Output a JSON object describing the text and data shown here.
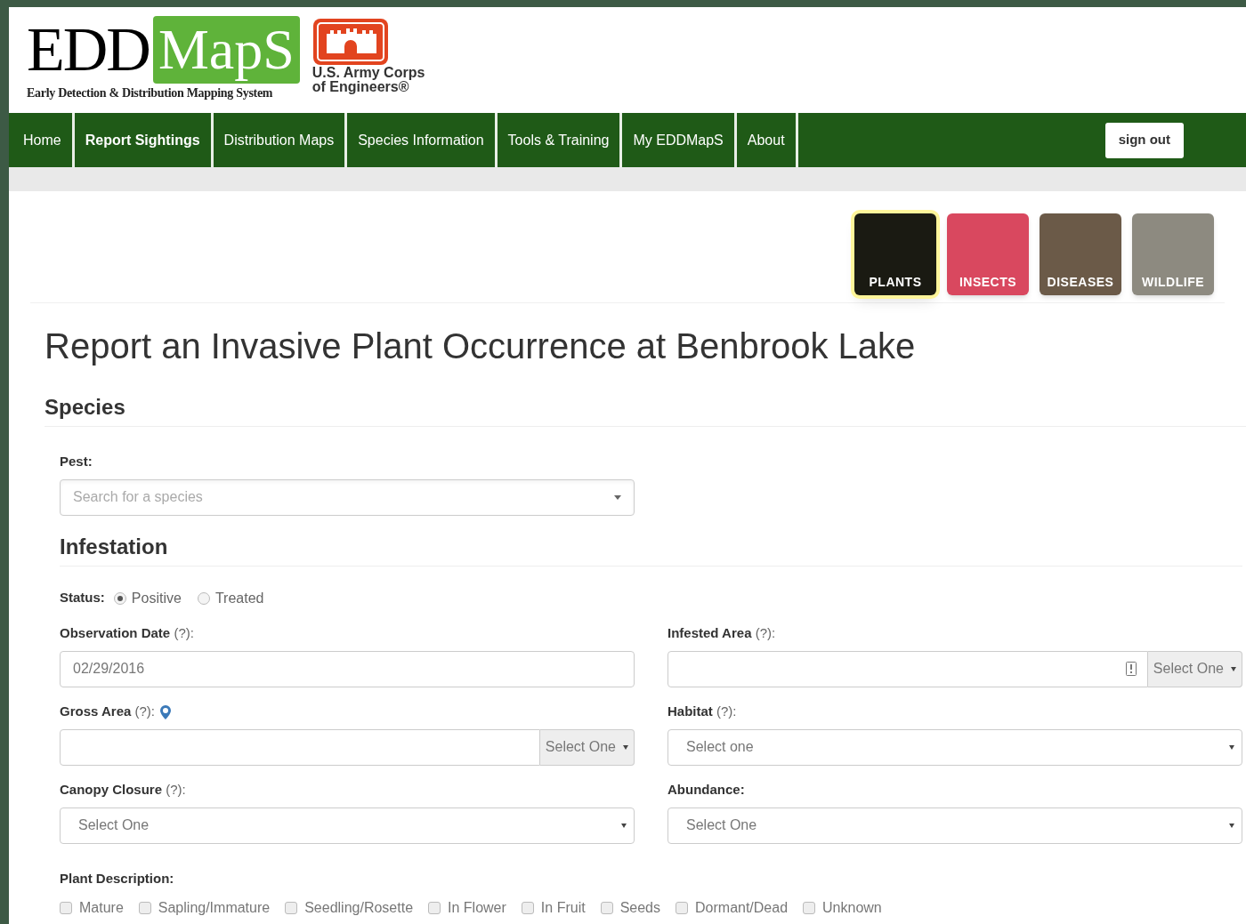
{
  "logo": {
    "word_1": "EDD",
    "word_2": "MapS",
    "tagline": "Early Detection & Distribution Mapping System",
    "partner_line_1": "U.S. Army Corps",
    "partner_line_2": "of Engineers®"
  },
  "nav": {
    "items": [
      {
        "label": "Home",
        "selected": false
      },
      {
        "label": "Report Sightings",
        "selected": true
      },
      {
        "label": "Distribution Maps",
        "selected": false
      },
      {
        "label": "Species Information",
        "selected": false
      },
      {
        "label": "Tools & Training",
        "selected": false
      },
      {
        "label": "My EDDMapS",
        "selected": false
      },
      {
        "label": "About",
        "selected": false
      }
    ],
    "sign_out": "sign out"
  },
  "categories": [
    {
      "label": "PLANTS",
      "selected": true,
      "color": "#1a1a12"
    },
    {
      "label": "INSECTS",
      "selected": false,
      "color": "#d9485f"
    },
    {
      "label": "DISEASES",
      "selected": false,
      "color": "#6b5a48"
    },
    {
      "label": "WILDLIFE",
      "selected": false,
      "color": "#8d8a80"
    }
  ],
  "title": "Report an Invasive Plant Occurrence at Benbrook Lake",
  "species": {
    "heading": "Species",
    "pest": {
      "label": "**Pest:**",
      "placeholder": "Search for a species"
    }
  },
  "infestation": {
    "heading": "Infestation",
    "status": {
      "label": "Status:",
      "options": [
        {
          "label": "Positive",
          "selected": true
        },
        {
          "label": "Treated",
          "selected": false
        }
      ]
    },
    "fields": [
      {
        "kind": "text",
        "label": "**Observation Date** (?):",
        "value": "02/29/2016"
      },
      {
        "kind": "addon",
        "label": "**Infested Area** (?):",
        "addon": "Select One",
        "calc": true
      },
      {
        "kind": "addon",
        "label": "**Gross Area** (?):",
        "addon": "Select One",
        "pin": true
      },
      {
        "kind": "select",
        "label": "**Habitat** (?):",
        "value": "Select one"
      },
      {
        "kind": "select",
        "label": "**Canopy Closure** (?):",
        "value": "Select One"
      },
      {
        "kind": "select",
        "label": "**Abundance:**",
        "value": "Select One"
      }
    ],
    "plant_description": {
      "label": "Plant Description:",
      "options": [
        {
          "label": "Mature",
          "checked": false
        },
        {
          "label": "Sapling/Immature",
          "checked": false
        },
        {
          "label": "Seedling/Rosette",
          "checked": false
        },
        {
          "label": "In Flower",
          "checked": false
        },
        {
          "label": "In Fruit",
          "checked": false
        },
        {
          "label": "Seeds",
          "checked": false
        },
        {
          "label": "Dormant/Dead",
          "checked": false
        },
        {
          "label": "Unknown",
          "checked": false
        }
      ]
    }
  }
}
